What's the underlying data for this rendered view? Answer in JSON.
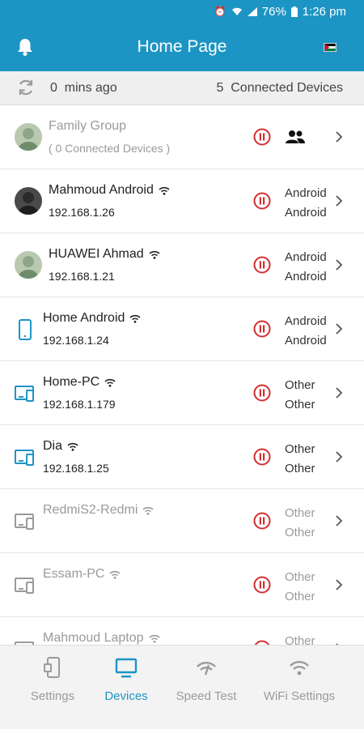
{
  "status_bar": {
    "battery": "76%",
    "time": "1:26 pm"
  },
  "header": {
    "title": "Home Page"
  },
  "summary": {
    "minutes": "0",
    "minutes_label": "mins ago",
    "count": "5",
    "count_label": "Connected Devices"
  },
  "devices": [
    {
      "name": "Family Group",
      "sub": "( 0  Connected Devices  )",
      "type1": "",
      "type2": "",
      "kind": "group",
      "dim": true
    },
    {
      "name": "Mahmoud Android",
      "sub": "192.168.1.26",
      "type1": "Android",
      "type2": "Android",
      "kind": "avatar"
    },
    {
      "name": " HUAWEI Ahmad",
      "sub": "192.168.1.21",
      "type1": "Android",
      "type2": "Android",
      "kind": "avatar"
    },
    {
      "name": "Home Android",
      "sub": "192.168.1.24",
      "type1": "Android",
      "type2": "Android",
      "kind": "phone"
    },
    {
      "name": "Home-PC",
      "sub": "192.168.1.179",
      "type1": "Other",
      "type2": "Other",
      "kind": "pc"
    },
    {
      "name": "Dia",
      "sub": "192.168.1.25",
      "type1": "Other",
      "type2": "Other",
      "kind": "pc"
    },
    {
      "name": "RedmiS2-Redmi",
      "sub": "",
      "type1": "Other",
      "type2": "Other",
      "kind": "pc",
      "dim": true
    },
    {
      "name": "Essam-PC",
      "sub": "",
      "type1": "Other",
      "type2": "Other",
      "kind": "pc",
      "dim": true
    },
    {
      "name": "Mahmoud Laptop",
      "sub": "",
      "type1": "Other",
      "type2": "Other",
      "kind": "pc",
      "dim": true
    }
  ],
  "bottom_nav": [
    {
      "label": "Settings",
      "icon": "settings-device-icon"
    },
    {
      "label": "Devices",
      "icon": "monitor-icon",
      "active": true
    },
    {
      "label": "Speed Test",
      "icon": "speed-test-icon"
    },
    {
      "label": "WiFi Settings",
      "icon": "wifi-icon"
    }
  ],
  "colors": {
    "primary": "#1d95c4",
    "pause_red": "#d32f2f",
    "dim_text": "#9a9a9a"
  }
}
